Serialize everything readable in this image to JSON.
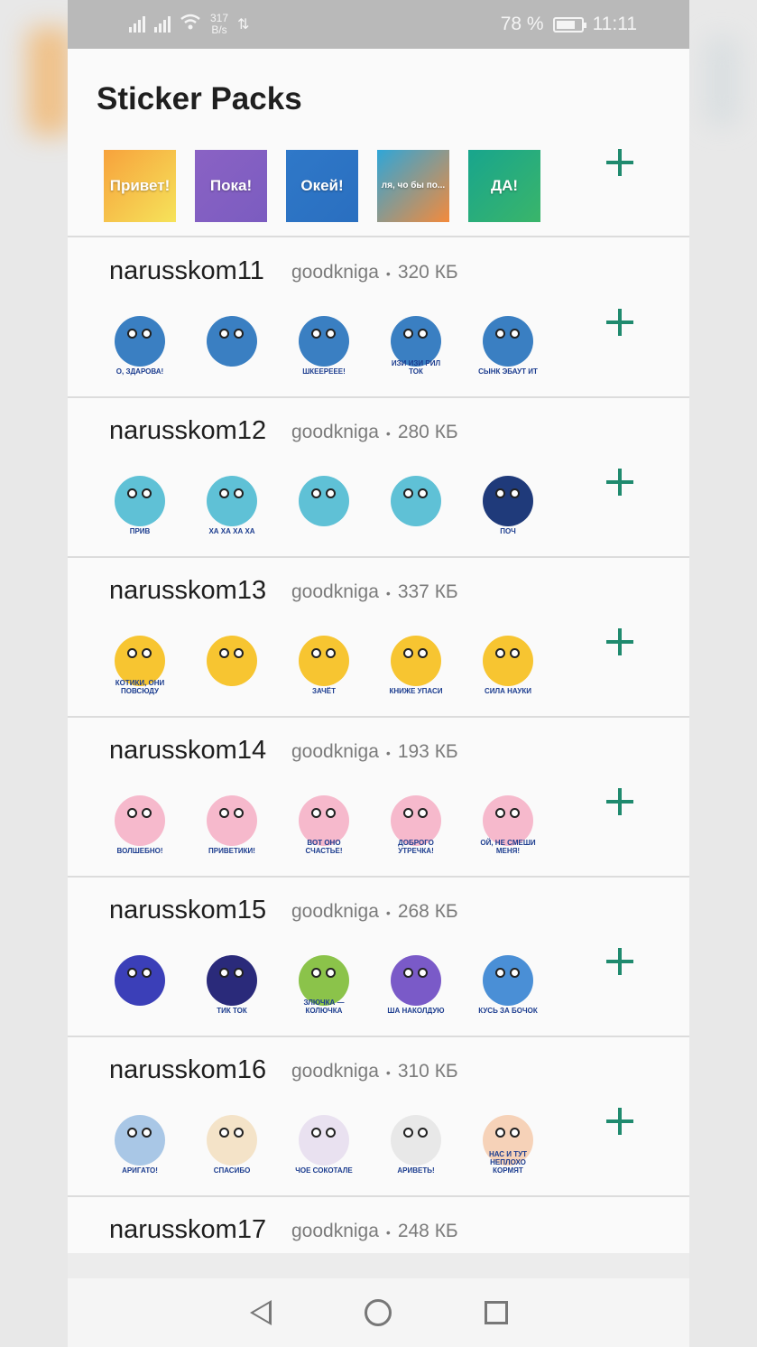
{
  "status_bar": {
    "net_speed_value": "317",
    "net_speed_unit": "B/s",
    "battery_percent": "78 %",
    "battery_level": 0.78,
    "time": "11:11"
  },
  "title": "Sticker Packs",
  "top_pack": {
    "tiles": [
      {
        "label": "Привет!",
        "color_from": "#f7a23c",
        "color_to": "#f6e35a"
      },
      {
        "label": "Пока!",
        "color_from": "#8a62c4",
        "color_to": "#7b5cc0"
      },
      {
        "label": "Окей!",
        "color_from": "#2f78c8",
        "color_to": "#2a6fc0"
      },
      {
        "label": "ля, чо бы по...",
        "color_from": "#2fa6d8",
        "color_to": "#f48a3b"
      },
      {
        "label": "ДА!",
        "color_from": "#18a58d",
        "color_to": "#3ab56a"
      }
    ]
  },
  "packs": [
    {
      "name": "narusskom11",
      "author": "goodkniga",
      "size": "320 КБ",
      "stickers": [
        {
          "color": "#3a7fc2",
          "caption": "О, ЗДАРОВА!"
        },
        {
          "color": "#3a7fc2",
          "caption": ""
        },
        {
          "color": "#3a7fc2",
          "caption": "ШКЕЕРЕЕЕ!"
        },
        {
          "color": "#3a7fc2",
          "caption": "ИЗИ ИЗИ РИЛ ТОК"
        },
        {
          "color": "#3a7fc2",
          "caption": "СЫНК ЭБАУТ ИТ"
        }
      ]
    },
    {
      "name": "narusskom12",
      "author": "goodkniga",
      "size": "280 КБ",
      "stickers": [
        {
          "color": "#5fc1d6",
          "caption": "ПРИВ"
        },
        {
          "color": "#5fc1d6",
          "caption": "ХА ХА ХА ХА"
        },
        {
          "color": "#5fc1d6",
          "caption": ""
        },
        {
          "color": "#5fc1d6",
          "caption": ""
        },
        {
          "color": "#1f3a7a",
          "caption": "ПОЧ"
        }
      ]
    },
    {
      "name": "narusskom13",
      "author": "goodkniga",
      "size": "337 КБ",
      "stickers": [
        {
          "color": "#f7c531",
          "caption": "КОТИКИ, ОНИ ПОВСЮДУ"
        },
        {
          "color": "#f7c531",
          "caption": ""
        },
        {
          "color": "#f7c531",
          "caption": "ЗАЧЁТ"
        },
        {
          "color": "#f7c531",
          "caption": "КНИЖЕ УПАСИ"
        },
        {
          "color": "#f7c531",
          "caption": "СИЛА НАУКИ"
        }
      ]
    },
    {
      "name": "narusskom14",
      "author": "goodkniga",
      "size": "193 КБ",
      "stickers": [
        {
          "color": "#f6b9cc",
          "caption": "ВОЛШЕБНО!"
        },
        {
          "color": "#f6b9cc",
          "caption": "ПРИВЕТИКИ!"
        },
        {
          "color": "#f6b9cc",
          "caption": "ВОТ ОНО СЧАСТЬЕ!"
        },
        {
          "color": "#f6b9cc",
          "caption": "ДОБРОГО УТРЕЧКА!"
        },
        {
          "color": "#f6b9cc",
          "caption": "ОЙ, НЕ СМЕШИ МЕНЯ!"
        }
      ]
    },
    {
      "name": "narusskom15",
      "author": "goodkniga",
      "size": "268 КБ",
      "stickers": [
        {
          "color": "#3b3fb8",
          "caption": ""
        },
        {
          "color": "#2a2a7a",
          "caption": "ТИК ТОК"
        },
        {
          "color": "#8bc34a",
          "caption": "ЗЛЮЧКА — КОЛЮЧКА"
        },
        {
          "color": "#7a5ac8",
          "caption": "ША НАКОЛДУЮ"
        },
        {
          "color": "#4a8fd6",
          "caption": "КУСЬ ЗА БОЧОК"
        }
      ]
    },
    {
      "name": "narusskom16",
      "author": "goodkniga",
      "size": "310 КБ",
      "stickers": [
        {
          "color": "#a9c7e6",
          "caption": "АРИГАТО!"
        },
        {
          "color": "#f4e3c8",
          "caption": "СПАСИБО"
        },
        {
          "color": "#e9e1f0",
          "caption": "ЧОЕ СОКОТАЛЕ"
        },
        {
          "color": "#e8e8e8",
          "caption": "АРИВЕТЬ!"
        },
        {
          "color": "#f6d2b8",
          "caption": "НАС И ТУТ НЕПЛОХО КОРМЯТ"
        }
      ]
    },
    {
      "name": "narusskom17",
      "author": "goodkniga",
      "size": "248 КБ",
      "stickers": []
    }
  ],
  "separator": "•"
}
